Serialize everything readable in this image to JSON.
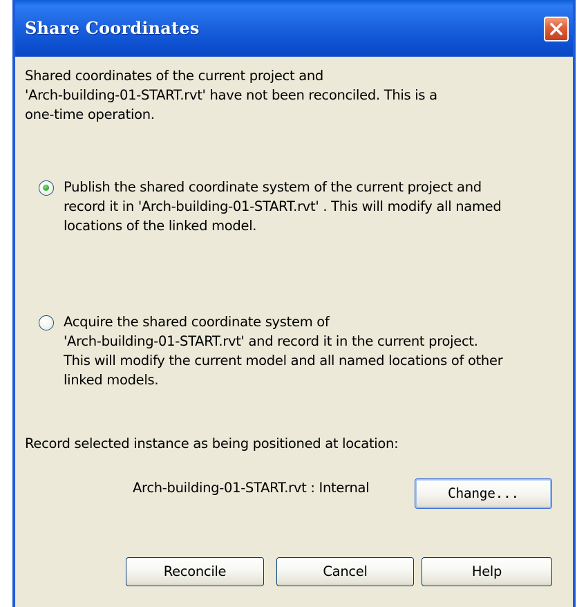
{
  "window": {
    "title": "Share Coordinates"
  },
  "dialog": {
    "intro": "Shared coordinates of the current project and\n'Arch-building-01-START.rvt' have not been reconciled. This is a\none-time operation.",
    "options": [
      {
        "label": "Publish the shared coordinate system of the current project and\nrecord it in 'Arch-building-01-START.rvt' . This will modify all named\nlocations of the linked model.",
        "selected": true
      },
      {
        "label": "Acquire the shared coordinate system of\n'Arch-building-01-START.rvt' and record it in the current project.\nThis will modify the current model and all named locations of other\nlinked models.",
        "selected": false
      }
    ],
    "record_label": "Record selected instance as being positioned at location:",
    "location_value": "Arch-building-01-START.rvt : Internal",
    "change_label": "Change..."
  },
  "buttons": {
    "reconcile": "Reconcile",
    "cancel": "Cancel",
    "help": "Help"
  },
  "colors": {
    "titlebar": "#0c4fcf",
    "dialog_bg": "#ece9d8",
    "radio_selected": "#2ea82e",
    "close_button": "#e0623c"
  },
  "icons": {
    "close": "close-icon"
  }
}
